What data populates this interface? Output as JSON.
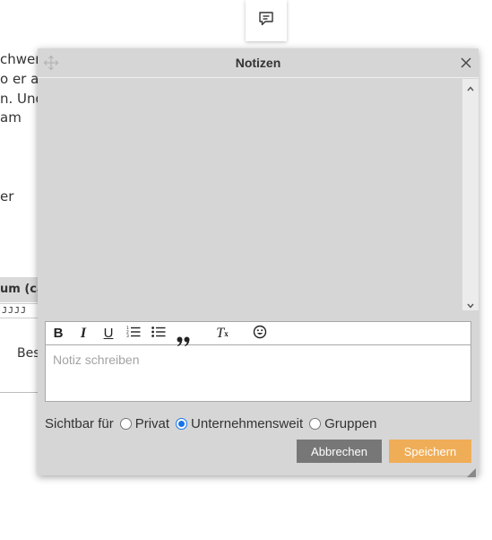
{
  "background": {
    "text_lines": [
      "chwer",
      "o er als",
      "n. Und",
      "am",
      "er"
    ],
    "column_header": "um (ca",
    "date_format": "JJJJ",
    "row_fragment": "Bes"
  },
  "notes_tab": {
    "icon": "comment-icon"
  },
  "dialog": {
    "title": "Notizen",
    "move_icon": "move-icon",
    "close_icon": "close-icon",
    "notes_list": [],
    "toolbar": {
      "bold": "B",
      "italic": "I",
      "underline": "U",
      "ordered_list_icon": "ordered-list-icon",
      "bullet_list_icon": "bullet-list-icon",
      "blockquote_icon": "blockquote-icon",
      "clear_format": "T",
      "clear_format_sub": "x",
      "emoji_icon": "emoji-icon"
    },
    "input": {
      "placeholder": "Notiz schreiben",
      "value": ""
    },
    "visibility": {
      "label": "Sichtbar für",
      "options": [
        {
          "label": "Privat",
          "checked": false
        },
        {
          "label": "Unternehmensweit",
          "checked": true
        },
        {
          "label": "Gruppen",
          "checked": false
        }
      ]
    },
    "buttons": {
      "cancel": "Abbrechen",
      "save": "Speichern"
    },
    "colors": {
      "save": "#f0ad57",
      "cancel": "#777777",
      "radio_checked": "#1a73e8",
      "dialog_bg": "#d6d6d6"
    }
  }
}
